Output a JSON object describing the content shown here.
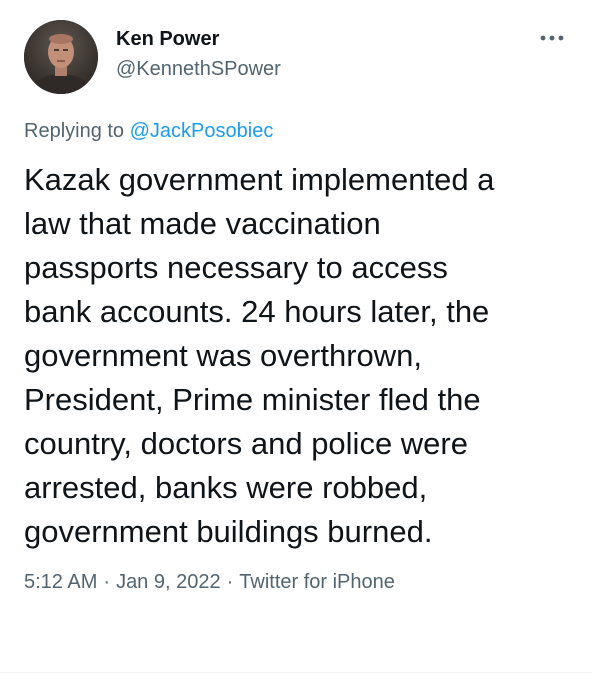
{
  "author": {
    "display_name": "Ken Power",
    "handle": "@KennethSPower",
    "avatar": "profile-photo"
  },
  "reply": {
    "prefix": "Replying to ",
    "mention": "@JackPosobiec"
  },
  "tweet": {
    "lines": [
      "Kazak government implemented a",
      "law that made vaccination",
      "passports necessary to access",
      "bank accounts. 24 hours later, the",
      "government was overthrown,",
      "President, Prime minister fled the",
      "country, doctors and police were",
      "arrested, banks were robbed,",
      "government buildings burned."
    ]
  },
  "meta": {
    "time": "5:12 AM",
    "date": "Jan 9, 2022",
    "source": "Twitter for iPhone",
    "separator": "·"
  },
  "icons": {
    "more": "more-horizontal-icon"
  },
  "colors": {
    "text": "#0f1419",
    "secondary": "#536471",
    "link": "#1d9bf0"
  }
}
